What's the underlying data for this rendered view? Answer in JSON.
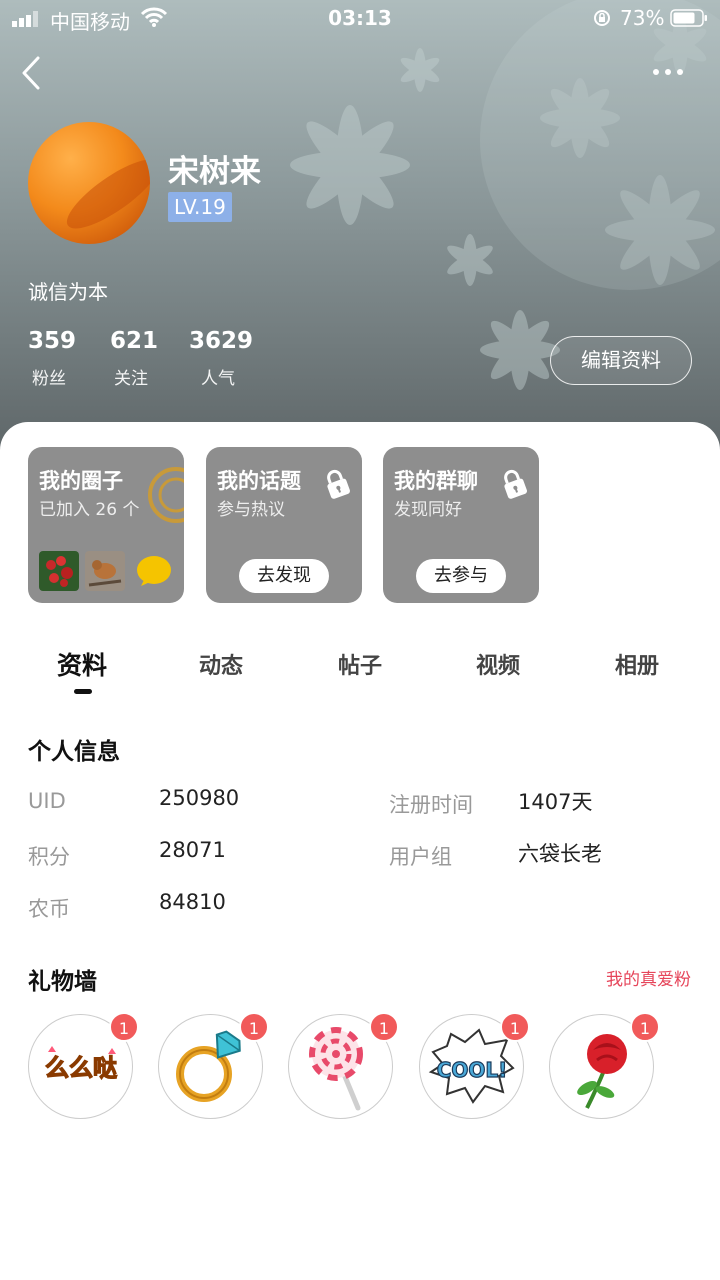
{
  "status_bar": {
    "carrier": "中国移动",
    "time": "03:13",
    "battery": "73%"
  },
  "profile": {
    "name": "宋树来",
    "level": "LV.19",
    "signature": "诚信为本",
    "stats": [
      {
        "value": "359",
        "label": "粉丝"
      },
      {
        "value": "621",
        "label": "关注"
      },
      {
        "value": "3629",
        "label": "人气"
      }
    ],
    "edit_label": "编辑资料"
  },
  "cards": {
    "circle": {
      "title": "我的圈子",
      "subtitle": "已加入 26 个"
    },
    "topic": {
      "title": "我的话题",
      "subtitle": "参与热议",
      "button": "去发现"
    },
    "group": {
      "title": "我的群聊",
      "subtitle": "发现同好",
      "button": "去参与"
    }
  },
  "tabs": [
    "资料",
    "动态",
    "帖子",
    "视频",
    "相册"
  ],
  "personal_info": {
    "title": "个人信息",
    "left": [
      {
        "label": "UID",
        "value": "250980"
      },
      {
        "label": "积分",
        "value": "28071"
      },
      {
        "label": "农币",
        "value": "84810"
      }
    ],
    "right": [
      {
        "label": "注册时间",
        "value": "1407天"
      },
      {
        "label": "用户组",
        "value": "六袋长老"
      }
    ]
  },
  "gift_wall": {
    "title": "礼物墙",
    "link": "我的真爱粉",
    "gifts": [
      {
        "icon": "memeda-text-icon",
        "text": "么么哒",
        "count": "1"
      },
      {
        "icon": "diamond-ring-icon",
        "count": "1"
      },
      {
        "icon": "lollipop-icon",
        "count": "1"
      },
      {
        "icon": "cool-sticker-icon",
        "text": "COOL!",
        "count": "1"
      },
      {
        "icon": "rose-icon",
        "count": "1"
      }
    ]
  }
}
